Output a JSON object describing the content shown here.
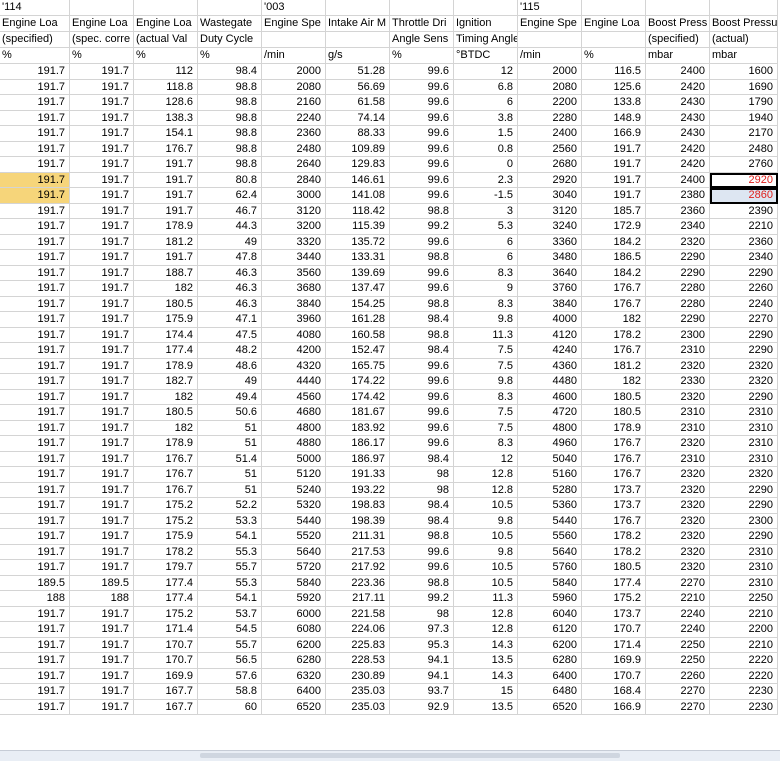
{
  "header_rows": [
    [
      "'114",
      "",
      "",
      "",
      "'003",
      "",
      "",
      "",
      "'115",
      "",
      "",
      ""
    ],
    [
      "Engine Loa",
      "Engine Loa",
      "Engine Loa",
      "Wastegate",
      "Engine Spe",
      "Intake Air M",
      "Throttle Dri",
      "Ignition",
      "Engine Spe",
      "Engine Loa",
      "Boost Press",
      "Boost Pressu"
    ],
    [
      "(specified)",
      "(spec. corre",
      "(actual Val",
      "Duty Cycle",
      "",
      "",
      "Angle Sens",
      "Timing Angle",
      "",
      "",
      "(specified)",
      "(actual)"
    ],
    [
      "%",
      "%",
      "%",
      "%",
      "/min",
      "g/s",
      "%",
      "°BTDC",
      "/min",
      "%",
      "mbar",
      "mbar"
    ]
  ],
  "rows": [
    [
      "191.7",
      "191.7",
      "112",
      "98.4",
      "2000",
      "51.28",
      "99.6",
      "12",
      "2000",
      "116.5",
      "2400",
      "1600"
    ],
    [
      "191.7",
      "191.7",
      "118.8",
      "98.8",
      "2080",
      "56.69",
      "99.6",
      "6.8",
      "2080",
      "125.6",
      "2420",
      "1690"
    ],
    [
      "191.7",
      "191.7",
      "128.6",
      "98.8",
      "2160",
      "61.58",
      "99.6",
      "6",
      "2200",
      "133.8",
      "2430",
      "1790"
    ],
    [
      "191.7",
      "191.7",
      "138.3",
      "98.8",
      "2240",
      "74.14",
      "99.6",
      "3.8",
      "2280",
      "148.9",
      "2430",
      "1940"
    ],
    [
      "191.7",
      "191.7",
      "154.1",
      "98.8",
      "2360",
      "88.33",
      "99.6",
      "1.5",
      "2400",
      "166.9",
      "2430",
      "2170"
    ],
    [
      "191.7",
      "191.7",
      "176.7",
      "98.8",
      "2480",
      "109.89",
      "99.6",
      "0.8",
      "2560",
      "191.7",
      "2420",
      "2480"
    ],
    [
      "191.7",
      "191.7",
      "191.7",
      "98.8",
      "2640",
      "129.83",
      "99.6",
      "0",
      "2680",
      "191.7",
      "2420",
      "2760"
    ],
    [
      "191.7",
      "191.7",
      "191.7",
      "80.8",
      "2840",
      "146.61",
      "99.6",
      "2.3",
      "2920",
      "191.7",
      "2400",
      "2920"
    ],
    [
      "191.7",
      "191.7",
      "191.7",
      "62.4",
      "3000",
      "141.08",
      "99.6",
      "-1.5",
      "3040",
      "191.7",
      "2380",
      "2860"
    ],
    [
      "191.7",
      "191.7",
      "191.7",
      "46.7",
      "3120",
      "118.42",
      "98.8",
      "3",
      "3120",
      "185.7",
      "2360",
      "2390"
    ],
    [
      "191.7",
      "191.7",
      "178.9",
      "44.3",
      "3200",
      "115.39",
      "99.2",
      "5.3",
      "3240",
      "172.9",
      "2340",
      "2210"
    ],
    [
      "191.7",
      "191.7",
      "181.2",
      "49",
      "3320",
      "135.72",
      "99.6",
      "6",
      "3360",
      "184.2",
      "2320",
      "2360"
    ],
    [
      "191.7",
      "191.7",
      "191.7",
      "47.8",
      "3440",
      "133.31",
      "98.8",
      "6",
      "3480",
      "186.5",
      "2290",
      "2340"
    ],
    [
      "191.7",
      "191.7",
      "188.7",
      "46.3",
      "3560",
      "139.69",
      "99.6",
      "8.3",
      "3640",
      "184.2",
      "2290",
      "2290"
    ],
    [
      "191.7",
      "191.7",
      "182",
      "46.3",
      "3680",
      "137.47",
      "99.6",
      "9",
      "3760",
      "176.7",
      "2280",
      "2260"
    ],
    [
      "191.7",
      "191.7",
      "180.5",
      "46.3",
      "3840",
      "154.25",
      "98.8",
      "8.3",
      "3840",
      "176.7",
      "2280",
      "2240"
    ],
    [
      "191.7",
      "191.7",
      "175.9",
      "47.1",
      "3960",
      "161.28",
      "98.4",
      "9.8",
      "4000",
      "182",
      "2290",
      "2270"
    ],
    [
      "191.7",
      "191.7",
      "174.4",
      "47.5",
      "4080",
      "160.58",
      "98.8",
      "11.3",
      "4120",
      "178.2",
      "2300",
      "2290"
    ],
    [
      "191.7",
      "191.7",
      "177.4",
      "48.2",
      "4200",
      "152.47",
      "98.4",
      "7.5",
      "4240",
      "176.7",
      "2310",
      "2290"
    ],
    [
      "191.7",
      "191.7",
      "178.9",
      "48.6",
      "4320",
      "165.75",
      "99.6",
      "7.5",
      "4360",
      "181.2",
      "2320",
      "2320"
    ],
    [
      "191.7",
      "191.7",
      "182.7",
      "49",
      "4440",
      "174.22",
      "99.6",
      "9.8",
      "4480",
      "182",
      "2330",
      "2320"
    ],
    [
      "191.7",
      "191.7",
      "182",
      "49.4",
      "4560",
      "174.42",
      "99.6",
      "8.3",
      "4600",
      "180.5",
      "2320",
      "2290"
    ],
    [
      "191.7",
      "191.7",
      "180.5",
      "50.6",
      "4680",
      "181.67",
      "99.6",
      "7.5",
      "4720",
      "180.5",
      "2310",
      "2310"
    ],
    [
      "191.7",
      "191.7",
      "182",
      "51",
      "4800",
      "183.92",
      "99.6",
      "7.5",
      "4800",
      "178.9",
      "2310",
      "2310"
    ],
    [
      "191.7",
      "191.7",
      "178.9",
      "51",
      "4880",
      "186.17",
      "99.6",
      "8.3",
      "4960",
      "176.7",
      "2320",
      "2310"
    ],
    [
      "191.7",
      "191.7",
      "176.7",
      "51.4",
      "5000",
      "186.97",
      "98.4",
      "12",
      "5040",
      "176.7",
      "2310",
      "2310"
    ],
    [
      "191.7",
      "191.7",
      "176.7",
      "51",
      "5120",
      "191.33",
      "98",
      "12.8",
      "5160",
      "176.7",
      "2320",
      "2320"
    ],
    [
      "191.7",
      "191.7",
      "176.7",
      "51",
      "5240",
      "193.22",
      "98",
      "12.8",
      "5280",
      "173.7",
      "2320",
      "2290"
    ],
    [
      "191.7",
      "191.7",
      "175.2",
      "52.2",
      "5320",
      "198.83",
      "98.4",
      "10.5",
      "5360",
      "173.7",
      "2320",
      "2290"
    ],
    [
      "191.7",
      "191.7",
      "175.2",
      "53.3",
      "5440",
      "198.39",
      "98.4",
      "9.8",
      "5440",
      "176.7",
      "2320",
      "2300"
    ],
    [
      "191.7",
      "191.7",
      "175.9",
      "54.1",
      "5520",
      "211.31",
      "98.8",
      "10.5",
      "5560",
      "178.2",
      "2320",
      "2290"
    ],
    [
      "191.7",
      "191.7",
      "178.2",
      "55.3",
      "5640",
      "217.53",
      "99.6",
      "9.8",
      "5640",
      "178.2",
      "2320",
      "2310"
    ],
    [
      "191.7",
      "191.7",
      "179.7",
      "55.7",
      "5720",
      "217.92",
      "99.6",
      "10.5",
      "5760",
      "180.5",
      "2320",
      "2310"
    ],
    [
      "189.5",
      "189.5",
      "177.4",
      "55.3",
      "5840",
      "223.36",
      "98.8",
      "10.5",
      "5840",
      "177.4",
      "2270",
      "2310"
    ],
    [
      "188",
      "188",
      "177.4",
      "54.1",
      "5920",
      "217.11",
      "99.2",
      "11.3",
      "5960",
      "175.2",
      "2210",
      "2250"
    ],
    [
      "191.7",
      "191.7",
      "175.2",
      "53.7",
      "6000",
      "221.58",
      "98",
      "12.8",
      "6040",
      "173.7",
      "2240",
      "2210"
    ],
    [
      "191.7",
      "191.7",
      "171.4",
      "54.5",
      "6080",
      "224.06",
      "97.3",
      "12.8",
      "6120",
      "170.7",
      "2240",
      "2200"
    ],
    [
      "191.7",
      "191.7",
      "170.7",
      "55.7",
      "6200",
      "225.83",
      "95.3",
      "14.3",
      "6200",
      "171.4",
      "2250",
      "2210"
    ],
    [
      "191.7",
      "191.7",
      "170.7",
      "56.5",
      "6280",
      "228.53",
      "94.1",
      "13.5",
      "6280",
      "169.9",
      "2250",
      "2220"
    ],
    [
      "191.7",
      "191.7",
      "169.9",
      "57.6",
      "6320",
      "230.89",
      "94.1",
      "14.3",
      "6400",
      "170.7",
      "2260",
      "2220"
    ],
    [
      "191.7",
      "191.7",
      "167.7",
      "58.8",
      "6400",
      "235.03",
      "93.7",
      "15",
      "6480",
      "168.4",
      "2270",
      "2230"
    ],
    [
      "191.7",
      "191.7",
      "167.7",
      "60",
      "6520",
      "235.03",
      "92.9",
      "13.5",
      "6520",
      "166.9",
      "2270",
      "2230"
    ]
  ],
  "highlight": {
    "selected_rows": [
      7,
      8
    ],
    "selected_row_color": "#f6d57a",
    "red_value_color": "#e0201c",
    "selection_fill": "#dde6f2"
  }
}
